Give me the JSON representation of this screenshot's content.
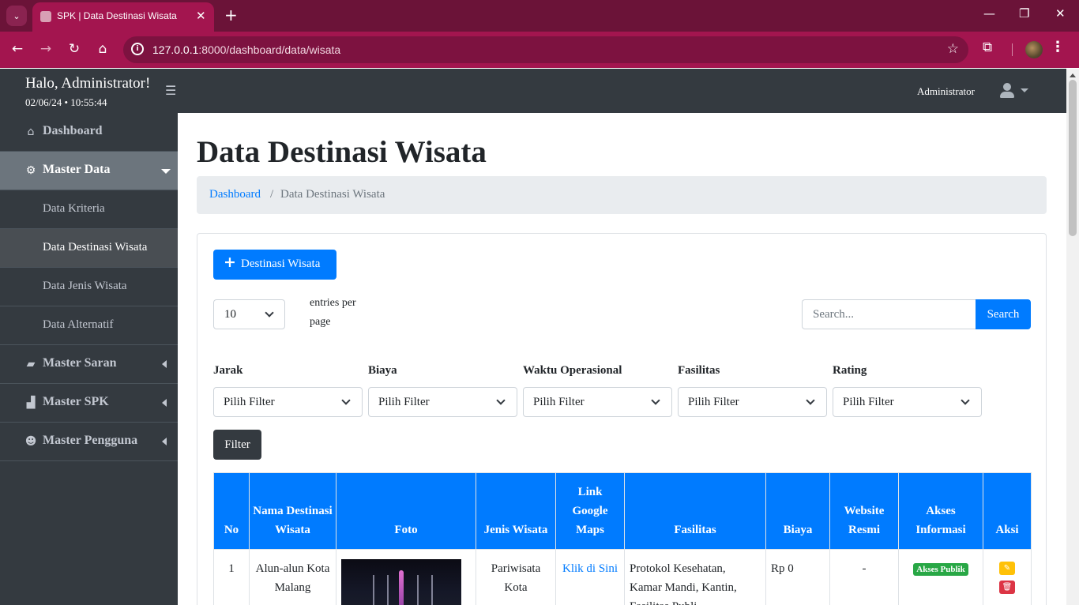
{
  "browser": {
    "tab_title": "SPK | Data Destinasi Wisata",
    "url_host": "127.0.0.1",
    "url_path": ":8000/dashboard/data/wisata"
  },
  "topbar": {
    "greeting": "Halo, Administrator!",
    "datetime": "02/06/24 • 10:55:44",
    "user_name": "Administrator"
  },
  "sidebar": {
    "items": [
      {
        "label": "Dashboard",
        "icon": "home-icon"
      },
      {
        "label": "Master Data",
        "icon": "cubes-icon",
        "open": true
      },
      {
        "label": "Data Kriteria"
      },
      {
        "label": "Data Destinasi Wisata",
        "active": true
      },
      {
        "label": "Data Jenis Wisata"
      },
      {
        "label": "Data Alternatif"
      },
      {
        "label": "Master Saran",
        "icon": "comment-icon"
      },
      {
        "label": "Master SPK",
        "icon": "chart-icon"
      },
      {
        "label": "Master Pengguna",
        "icon": "users-cog-icon"
      }
    ]
  },
  "page": {
    "title": "Data Destinasi Wisata",
    "breadcrumb": {
      "home": "Dashboard",
      "sep": "/",
      "current": "Data Destinasi Wisata"
    }
  },
  "controls": {
    "add_button": "Destinasi Wisata",
    "entries_value": "10",
    "entries_label": "entries per page",
    "search_placeholder": "Search...",
    "search_button": "Search",
    "filter_button": "Filter",
    "filters": [
      {
        "label": "Jarak",
        "value": "Pilih Filter"
      },
      {
        "label": "Biaya",
        "value": "Pilih Filter"
      },
      {
        "label": "Waktu Operasional",
        "value": "Pilih Filter"
      },
      {
        "label": "Fasilitas",
        "value": "Pilih Filter"
      },
      {
        "label": "Rating",
        "value": "Pilih Filter"
      }
    ]
  },
  "table": {
    "headers": [
      "No",
      "Nama Destinasi Wisata",
      "Foto",
      "Jenis Wisata",
      "Link Google Maps",
      "Fasilitas",
      "Biaya",
      "Website Resmi",
      "Akses Informasi",
      "Aksi"
    ],
    "rows": [
      {
        "no": "1",
        "nama": "Alun-alun Kota Malang",
        "jenis": "Pariwisata Kota",
        "link": "Klik di Sini",
        "fasilitas": "Protokol Kesehatan, Kamar Mandi, Kantin, Fasilitas Publi...",
        "biaya": "Rp 0",
        "website": "-",
        "akses": "Akses Publik"
      }
    ]
  },
  "colors": {
    "browser_frame": "#a3154f",
    "sidebar": "#343a40",
    "primary": "#007bff",
    "success": "#28a745",
    "warning": "#ffc107",
    "danger": "#dc3545"
  }
}
